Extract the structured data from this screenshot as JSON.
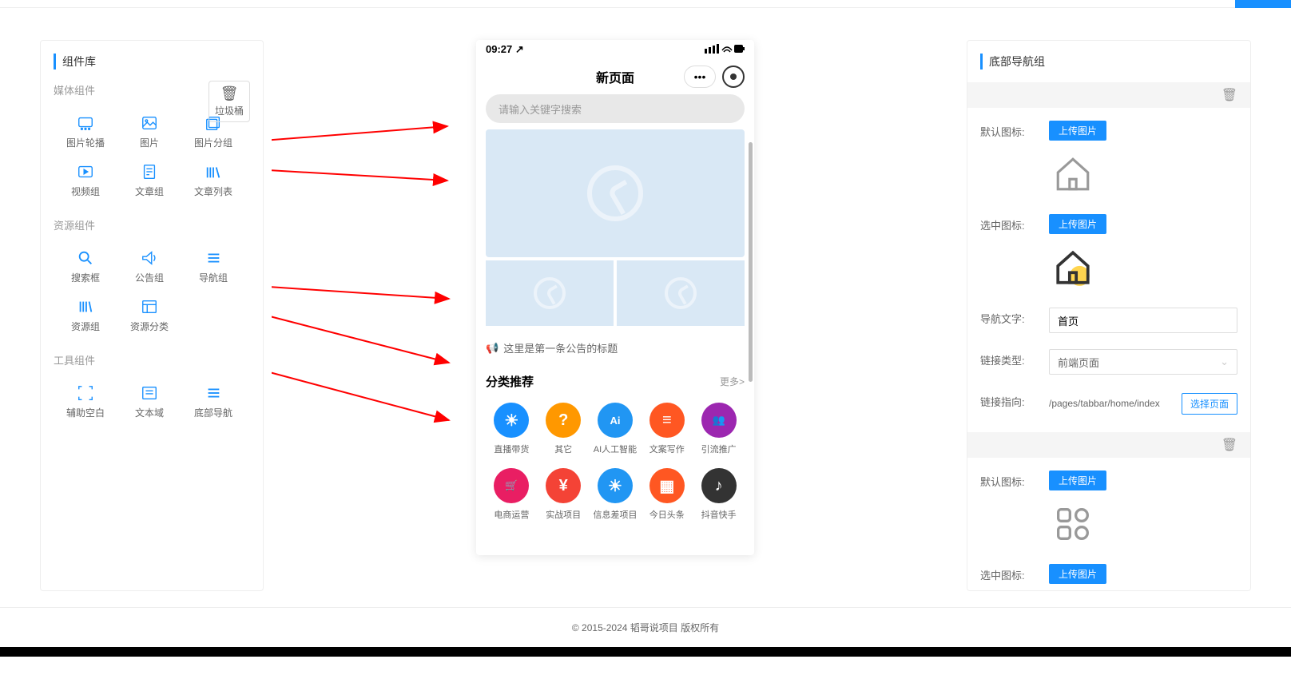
{
  "left_panel": {
    "title": "组件库",
    "trash": "垃圾桶",
    "sections": {
      "media": "媒体组件",
      "resource": "资源组件",
      "tool": "工具组件"
    },
    "media_items": [
      {
        "label": "图片轮播",
        "icon": "carousel"
      },
      {
        "label": "图片",
        "icon": "image"
      },
      {
        "label": "图片分组",
        "icon": "group"
      },
      {
        "label": "视频组",
        "icon": "video"
      },
      {
        "label": "文章组",
        "icon": "article"
      },
      {
        "label": "文章列表",
        "icon": "article-list"
      }
    ],
    "resource_items": [
      {
        "label": "搜索框",
        "icon": "search"
      },
      {
        "label": "公告组",
        "icon": "announce"
      },
      {
        "label": "导航组",
        "icon": "nav"
      },
      {
        "label": "资源组",
        "icon": "resource"
      },
      {
        "label": "资源分类",
        "icon": "category"
      }
    ],
    "tool_items": [
      {
        "label": "辅助空白",
        "icon": "blank"
      },
      {
        "label": "文本域",
        "icon": "textarea"
      },
      {
        "label": "底部导航",
        "icon": "bottom-nav"
      }
    ]
  },
  "phone": {
    "time": "09:27",
    "title": "新页面",
    "search_placeholder": "请输入关键字搜索",
    "announce_text": "这里是第一条公告的标题",
    "category_title": "分类推荐",
    "more": "更多>",
    "categories": [
      {
        "label": "直播带货",
        "color": "#1890ff",
        "emoji": "☀"
      },
      {
        "label": "其它",
        "color": "#ff9800",
        "emoji": "?"
      },
      {
        "label": "AI人工智能",
        "color": "#2196f3",
        "emoji": "Ai"
      },
      {
        "label": "文案写作",
        "color": "#ff5722",
        "emoji": "≡"
      },
      {
        "label": "引流推广",
        "color": "#9c27b0",
        "emoji": "👥"
      },
      {
        "label": "电商运营",
        "color": "#e91e63",
        "emoji": "🛒"
      },
      {
        "label": "实战项目",
        "color": "#f44336",
        "emoji": "¥"
      },
      {
        "label": "信息差项目",
        "color": "#2196f3",
        "emoji": "☀"
      },
      {
        "label": "今日头条",
        "color": "#ff5722",
        "emoji": "▦"
      },
      {
        "label": "抖音快手",
        "color": "#333333",
        "emoji": "♪"
      }
    ]
  },
  "right_panel": {
    "title": "底部导航组",
    "default_icon_label": "默认图标:",
    "active_icon_label": "选中图标:",
    "nav_text_label": "导航文字:",
    "link_type_label": "链接类型:",
    "link_target_label": "链接指向:",
    "upload_btn": "上传图片",
    "nav1_text": "首页",
    "link_type_value": "前端页面",
    "link_target_value": "/pages/tabbar/home/index",
    "select_page_btn": "选择页面"
  },
  "footer": "© 2015-2024 韬哥说项目 版权所有"
}
